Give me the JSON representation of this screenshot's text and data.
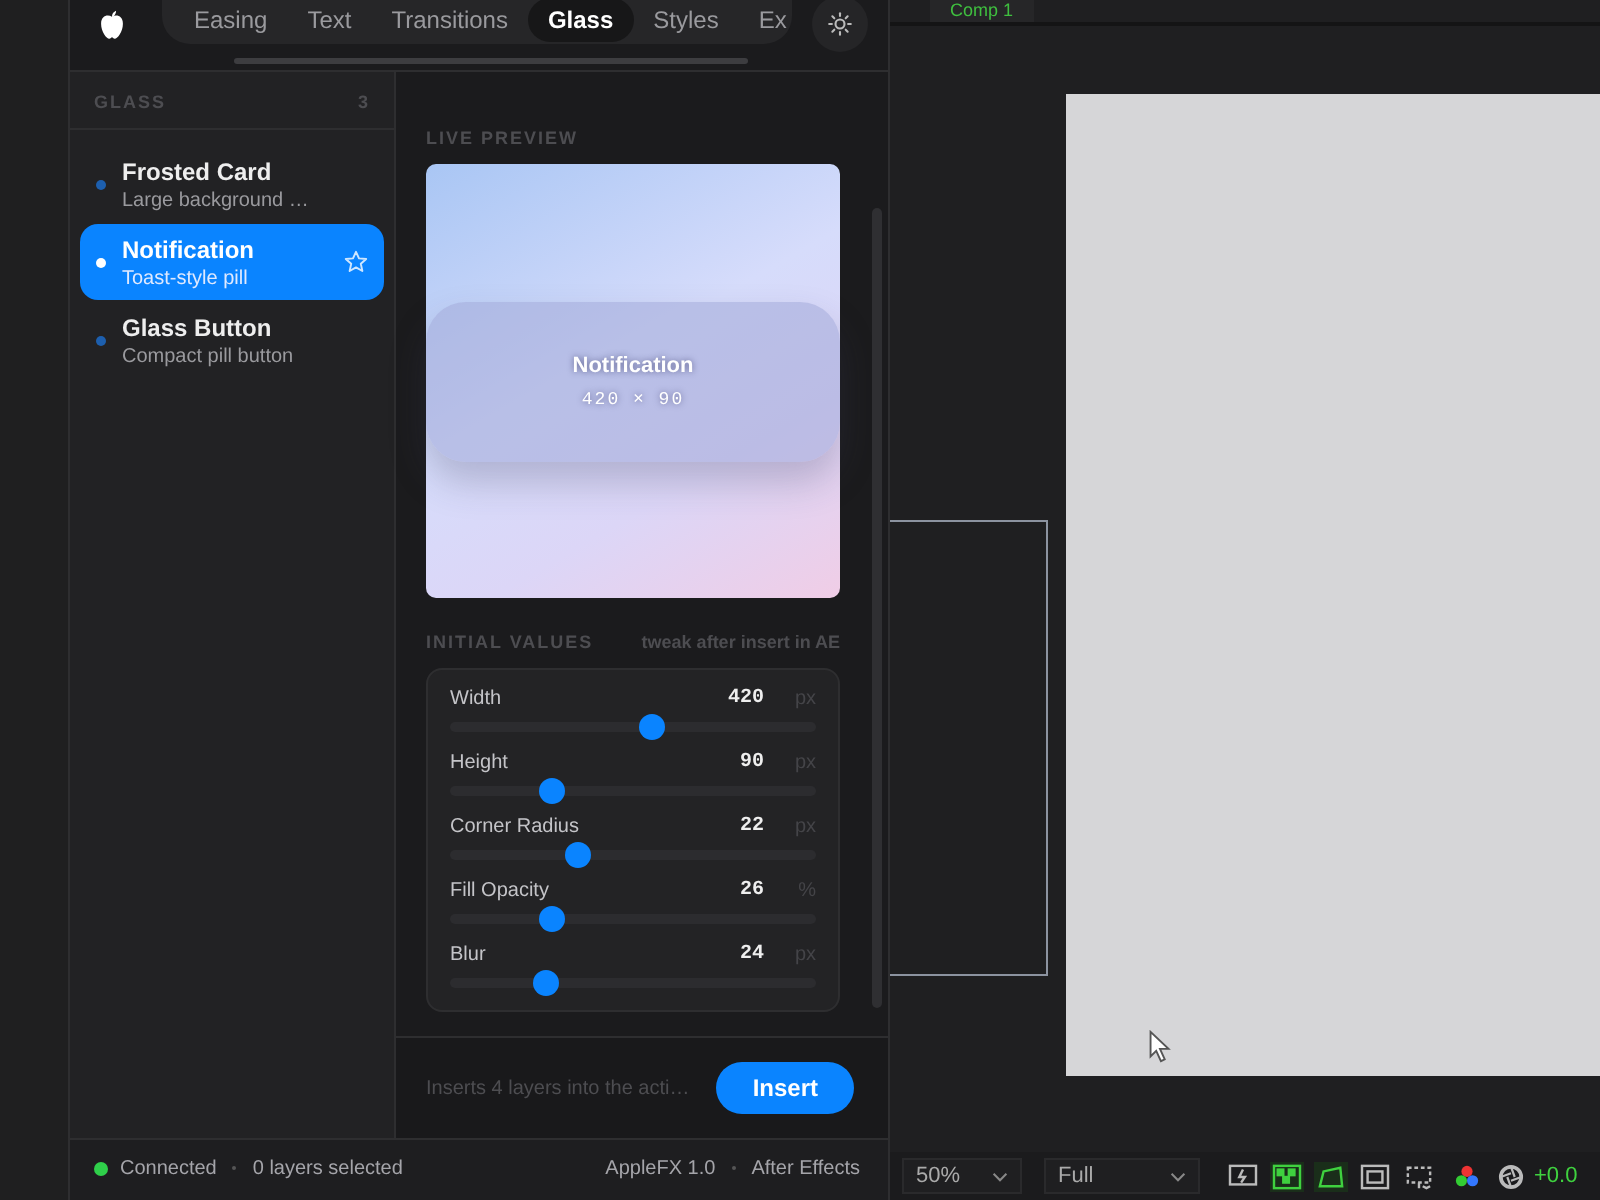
{
  "tabs": [
    {
      "label": "Easing",
      "selected": false
    },
    {
      "label": "Text",
      "selected": false
    },
    {
      "label": "Transitions",
      "selected": false
    },
    {
      "label": "Glass",
      "selected": true
    },
    {
      "label": "Styles",
      "selected": false
    },
    {
      "label": "Ex",
      "selected": false
    }
  ],
  "sidebar": {
    "title": "GLASS",
    "count": "3",
    "items": [
      {
        "name": "Frosted Card",
        "description": "Large background …",
        "selected": false
      },
      {
        "name": "Notification",
        "description": "Toast-style pill",
        "selected": true
      },
      {
        "name": "Glass Button",
        "description": "Compact pill button",
        "selected": false
      }
    ]
  },
  "preview": {
    "label": "LIVE PREVIEW",
    "title": "Notification",
    "size": "420 × 90"
  },
  "initial_values": {
    "label": "INITIAL VALUES",
    "hint": "tweak after insert in AE",
    "params": [
      {
        "name": "Width",
        "value": "420",
        "unit": "px",
        "level": 0.55
      },
      {
        "name": "Height",
        "value": "90",
        "unit": "px",
        "level": 0.28
      },
      {
        "name": "Corner Radius",
        "value": "22",
        "unit": "px",
        "level": 0.35
      },
      {
        "name": "Fill Opacity",
        "value": "26",
        "unit": "%",
        "level": 0.28
      },
      {
        "name": "Blur",
        "value": "24",
        "unit": "px",
        "level": 0.26
      }
    ]
  },
  "footer": {
    "hint": "Inserts 4 layers into the acti…",
    "button": "Insert"
  },
  "status_bar": {
    "connected": true,
    "connection": "Connected",
    "selection": "0 layers selected",
    "version": "AppleFX 1.0",
    "host": "After Effects"
  },
  "viewer": {
    "comp_tab": "Comp 1",
    "zoom": "50%",
    "resolution": "Full",
    "toggles": [
      {
        "kind": "snapshot",
        "on": false
      },
      {
        "kind": "transparency",
        "on": true
      },
      {
        "kind": "mask",
        "on": true
      },
      {
        "kind": "safe",
        "on": false
      },
      {
        "kind": "region",
        "on": false
      }
    ],
    "exposure": "+0.0"
  }
}
